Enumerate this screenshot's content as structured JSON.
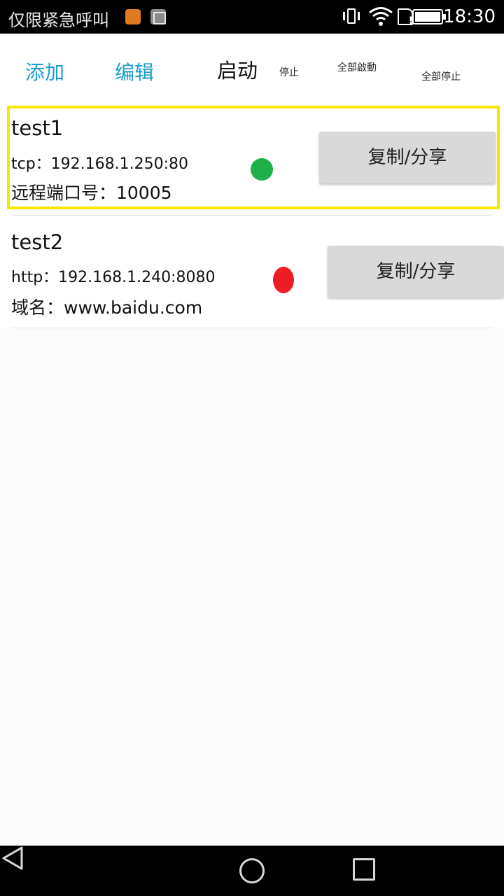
{
  "status_bar": {
    "carrier": "仅限紧急呼叫",
    "time": "18:30",
    "icons": [
      "uc-browser-icon",
      "gallery-icon",
      "vibrate-icon",
      "wifi-icon",
      "sim-alert-icon",
      "battery-icon"
    ]
  },
  "toolbar": {
    "add": "添加",
    "edit": "编辑",
    "start": "启动",
    "stop": "停止",
    "start_all": "全部啟動",
    "stop_all": "全部停止"
  },
  "colors": {
    "accent": "#1a9bd0",
    "running": "#1fb04a",
    "stopped": "#ee1c24",
    "selection": "#f5e900"
  },
  "items": [
    {
      "name": "test1",
      "address": "tcp：192.168.1.250:80",
      "extra": "远程端口号：10005",
      "status": "running",
      "selected": true,
      "share_label": "复制/分享"
    },
    {
      "name": "test2",
      "address": "http：192.168.1.240:8080",
      "extra": "域名：www.baidu.com",
      "status": "stopped",
      "selected": false,
      "share_label": "复制/分享"
    }
  ]
}
